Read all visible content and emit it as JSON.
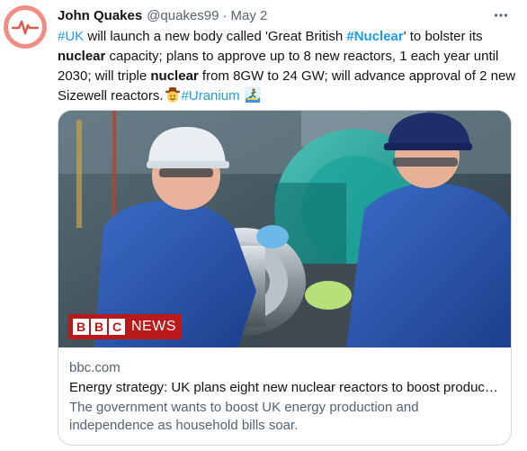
{
  "tweet": {
    "author": {
      "display_name": "John Quakes",
      "handle": "@quakes99",
      "separator": "·",
      "date": "May 2"
    },
    "more_label": "···",
    "text": {
      "hashtag_uk": "#UK",
      "part1": " will launch a new body called 'Great British ",
      "hashtag_nuclear": "#Nuclear",
      "part2": "' to bolster its ",
      "kw_nuclear_1": "nuclear",
      "part3": " capacity; plans to approve up to 8 new reactors, 1 each year until 2030; will triple ",
      "kw_nuclear_2": "nuclear",
      "part4": " from 8GW to 24 GW; will advance approval of 2 new Sizewell reactors.",
      "hashtag_uranium": "#Uranium",
      "emoji_1": "cowboy-face-emoji",
      "emoji_2": "surfer-emoji"
    },
    "card": {
      "image_logo_letters": [
        "B",
        "B",
        "C"
      ],
      "image_logo_word": "NEWS",
      "domain": "bbc.com",
      "title": "Energy strategy: UK plans eight new nuclear reactors to boost production",
      "description": "The government wants to boost UK energy production and independence as household bills soar."
    }
  },
  "colors": {
    "link": "#1d9bf0",
    "secondary_text": "#536471",
    "primary_text": "#0f1419",
    "avatar_bg": "#f08d85",
    "bbc_red": "#bb1919"
  }
}
